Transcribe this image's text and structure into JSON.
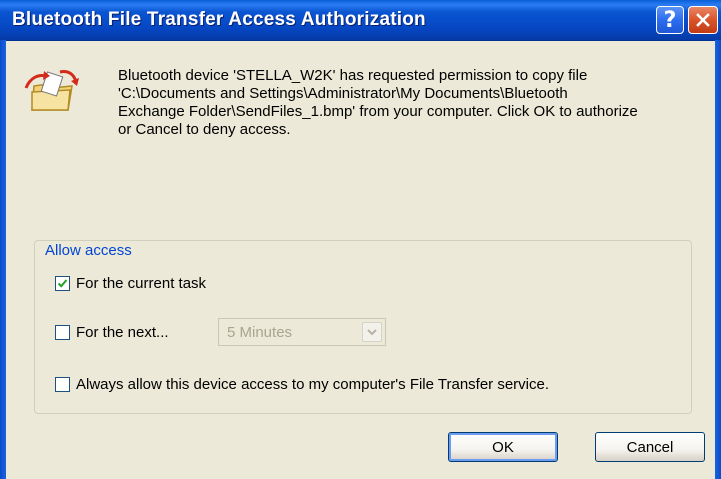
{
  "window": {
    "title": "Bluetooth File Transfer Access Authorization",
    "help_icon_text": "?"
  },
  "message": {
    "line1": "Bluetooth device 'STELLA_W2K' has requested permission to copy file",
    "line2": "'C:\\Documents and Settings\\Administrator\\My Documents\\Bluetooth",
    "line3": "Exchange Folder\\SendFiles_1.bmp' from your computer.  Click OK to authorize",
    "line4": "or Cancel to deny access."
  },
  "access_group": {
    "legend": "Allow access",
    "current_task": {
      "label": "For the current task",
      "checked": true
    },
    "for_next": {
      "label": "For the next...",
      "checked": false
    },
    "duration_select": {
      "value": "5 Minutes",
      "enabled": false
    },
    "always_allow": {
      "label": "Always allow this device access to my computer's File Transfer service.",
      "checked": false
    }
  },
  "buttons": {
    "ok": "OK",
    "cancel": "Cancel"
  },
  "icons": {
    "app": "file-transfer-icon",
    "help": "help-icon",
    "close": "close-icon",
    "check": "check-icon",
    "dropdown": "chevron-down-icon"
  },
  "colors": {
    "titlebar": "#0a55d2",
    "dialog_bg": "#ece9d8",
    "group_legend": "#0046d5",
    "close_button": "#d9542b",
    "checkmark": "#21a121"
  }
}
